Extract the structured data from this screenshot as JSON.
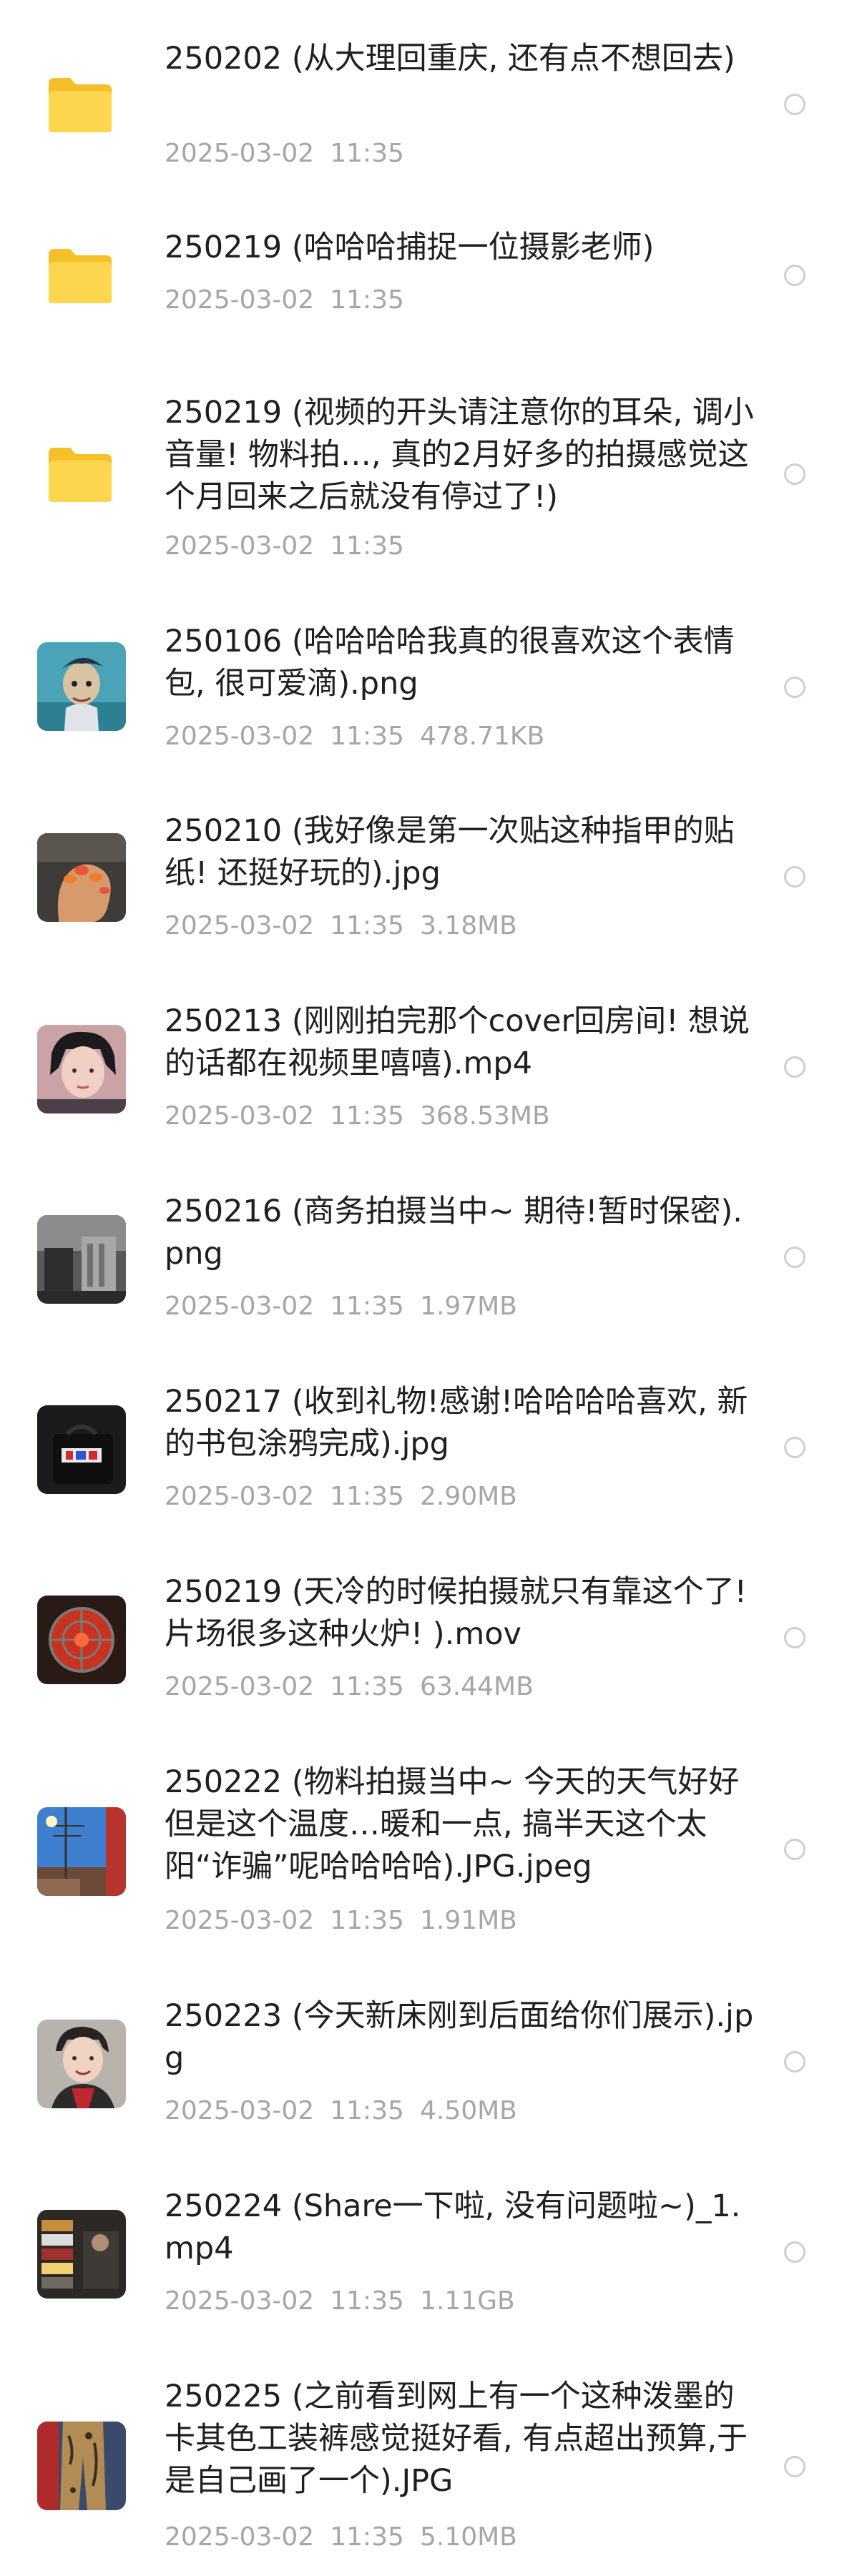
{
  "files": [
    {
      "name": "250202 (从大理回重庆, 还有点不想回去)",
      "date": "2025-03-02",
      "time": "11:35",
      "size": "",
      "icon": "folder-icon"
    },
    {
      "name": "250219 (哈哈哈捕捉一位摄影老师)",
      "date": "2025-03-02",
      "time": "11:35",
      "size": "",
      "icon": "folder-icon"
    },
    {
      "name": "250219 (视频的开头请注意你的耳朵, 调小音量! 物料拍…, 真的2月好多的拍摄感觉这个月回来之后就没有停过了!)",
      "date": "2025-03-02",
      "time": "11:35",
      "size": "",
      "icon": "folder-icon"
    },
    {
      "name": "250106 (哈哈哈哈我真的很喜欢这个表情包, 很可爱滴).png",
      "date": "2025-03-02",
      "time": "11:35",
      "size": "478.71KB",
      "icon": "image-thumbnail"
    },
    {
      "name": "250210 (我好像是第一次贴这种指甲的贴纸! 还挺好玩的).jpg",
      "date": "2025-03-02",
      "time": "11:35",
      "size": "3.18MB",
      "icon": "image-thumbnail"
    },
    {
      "name": "250213 (刚刚拍完那个cover回房间! 想说的话都在视频里嘻嘻).mp4",
      "date": "2025-03-02",
      "time": "11:35",
      "size": "368.53MB",
      "icon": "video-thumbnail"
    },
    {
      "name": "250216 (商务拍摄当中~ 期待!暂时保密).png",
      "date": "2025-03-02",
      "time": "11:35",
      "size": "1.97MB",
      "icon": "image-thumbnail"
    },
    {
      "name": "250217 (收到礼物!感谢!哈哈哈哈喜欢, 新的书包涂鸦完成).jpg",
      "date": "2025-03-02",
      "time": "11:35",
      "size": "2.90MB",
      "icon": "image-thumbnail"
    },
    {
      "name": "250219 (天冷的时候拍摄就只有靠这个了! 片场很多这种火炉! ).mov",
      "date": "2025-03-02",
      "time": "11:35",
      "size": "63.44MB",
      "icon": "video-thumbnail"
    },
    {
      "name": "250222 (物料拍摄当中~  今天的天气好好 但是这个温度…暖和一点, 搞半天这个太阳“诈骗”呢哈哈哈哈).JPG.jpeg",
      "date": "2025-03-02",
      "time": "11:35",
      "size": "1.91MB",
      "icon": "image-thumbnail"
    },
    {
      "name": "250223 (今天新床刚到后面给你们展示).jpg",
      "date": "2025-03-02",
      "time": "11:35",
      "size": "4.50MB",
      "icon": "image-thumbnail"
    },
    {
      "name": "250224 (Share一下啦, 没有问题啦~)_1.mp4",
      "date": "2025-03-02",
      "time": "11:35",
      "size": "1.11GB",
      "icon": "video-thumbnail"
    },
    {
      "name": "250225 (之前看到网上有一个这种泼墨的卡其色工装裤感觉挺好看, 有点超出预算,于是自己画了一个).JPG",
      "date": "2025-03-02",
      "time": "11:35",
      "size": "5.10MB",
      "icon": "image-thumbnail"
    }
  ],
  "colors": {
    "folder": "#fdd64f",
    "folder_tab": "#f5bf2a",
    "title": "#1f1f1f",
    "meta": "#a6a6a6",
    "radio_border": "#cfcfcf"
  }
}
